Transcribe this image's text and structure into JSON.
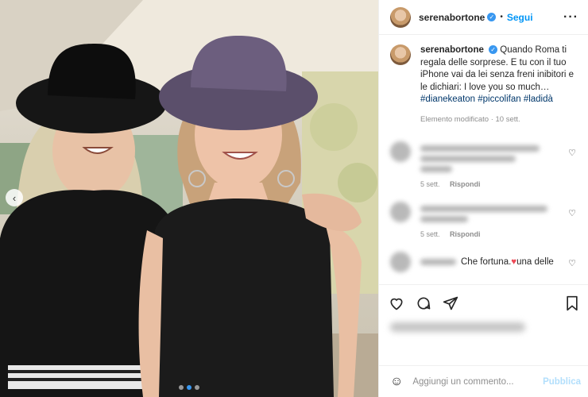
{
  "post": {
    "username": "serenabortone",
    "follow_label": "Segui",
    "separator": "•",
    "more_icon": "more-icon",
    "verified_icon": "verified-badge-icon"
  },
  "caption": {
    "username": "serenabortone",
    "text": "Quando Roma ti regala delle sorprese. E tu con il tuo iPhone vai da lei senza freni inibitori e le dichiari: I love you so much…",
    "hashtags": [
      "#dianekeaton",
      "#piccolifan",
      "#ladidà"
    ],
    "meta": "Elemento modificato · 10 sett."
  },
  "comments": [
    {
      "time": "5 sett.",
      "reply_label": "Rispondi"
    },
    {
      "time": "5 sett.",
      "reply_label": "Rispondi"
    },
    {
      "text": "Che fortuna.",
      "text_after": "una delle"
    }
  ],
  "actions": {
    "like_icon": "heart-icon",
    "comment_icon": "comment-icon",
    "share_icon": "share-icon",
    "save_icon": "bookmark-icon"
  },
  "add_comment": {
    "placeholder": "Aggiungi un commento...",
    "publish_label": "Pubblica",
    "emoji_icon": "emoji-icon"
  },
  "carousel": {
    "total_slides": 3,
    "current_slide": 2
  },
  "colors": {
    "accent": "#0095f6",
    "verified": "#3897f0",
    "hashtag": "#00376b",
    "muted": "#8e8e8e",
    "heart_red": "#ed4956"
  }
}
